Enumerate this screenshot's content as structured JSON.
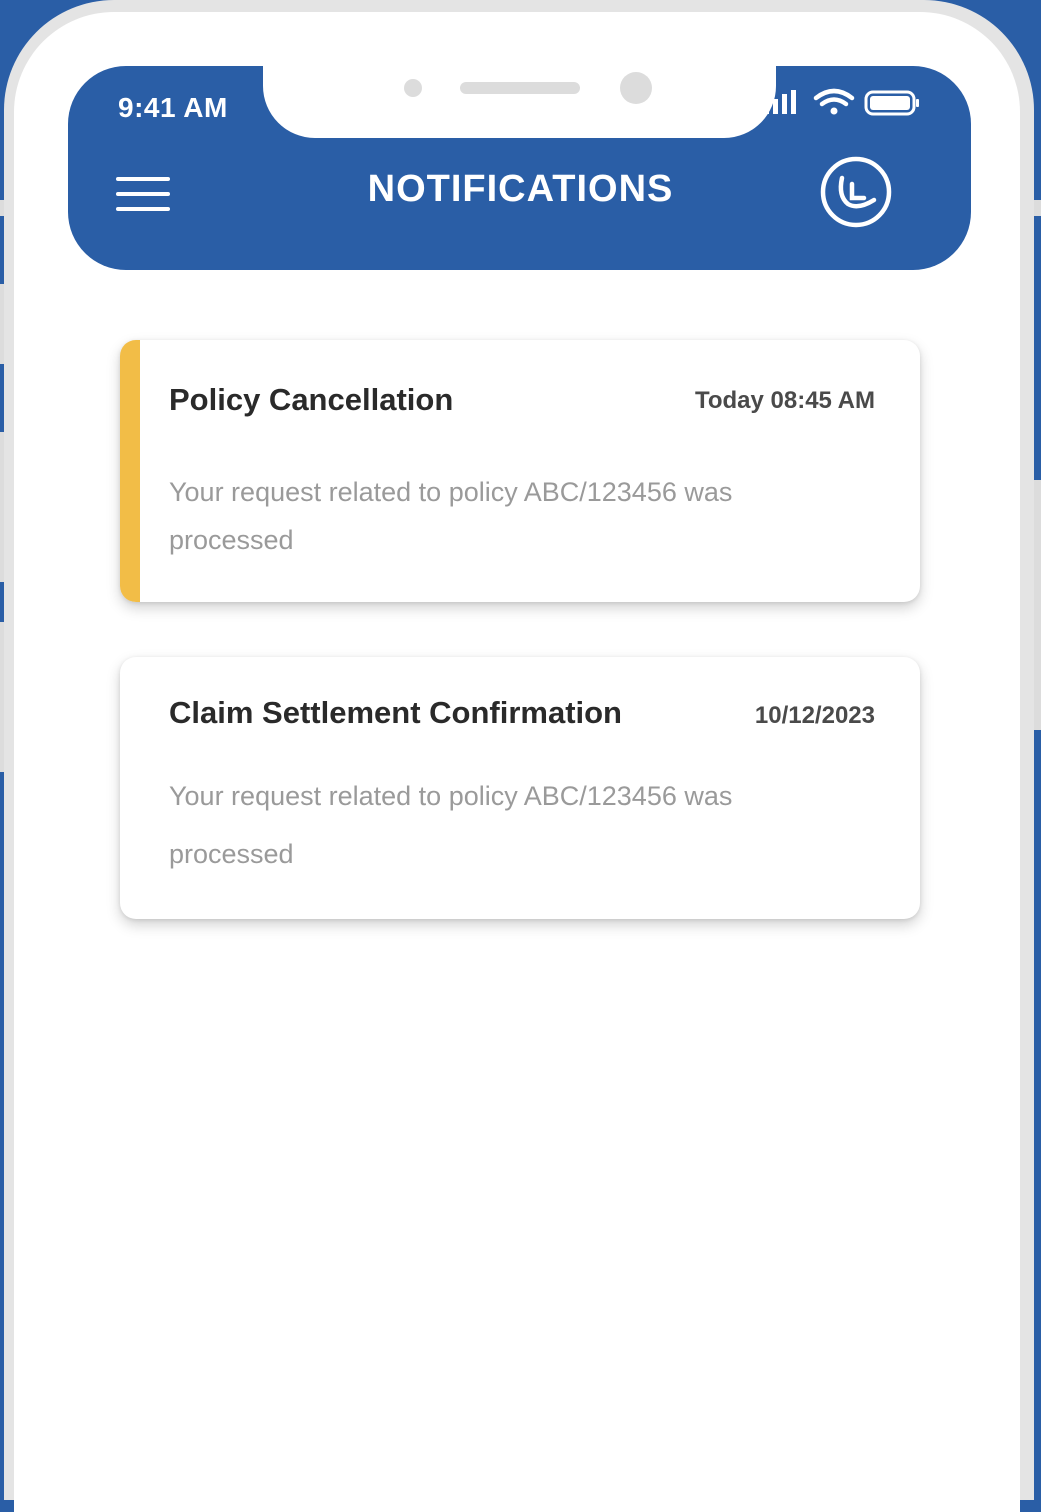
{
  "status_bar": {
    "time": "9:41 AM"
  },
  "header": {
    "title": "NOTIFICATIONS",
    "menu_icon": "hamburger-menu-icon",
    "support_icon": "support-agent-icon"
  },
  "colors": {
    "brand": "#2a5ea6",
    "accent": "#f2bd47"
  },
  "notifications": [
    {
      "title": "Policy Cancellation",
      "time": "Today 08:45 AM",
      "body": "Your request related to policy ABC/123456 was processed",
      "unread": true
    },
    {
      "title": "Claim Settlement Confirmation",
      "time": "10/12/2023",
      "body": "Your request related to policy ABC/123456 was processed",
      "unread": false
    }
  ]
}
